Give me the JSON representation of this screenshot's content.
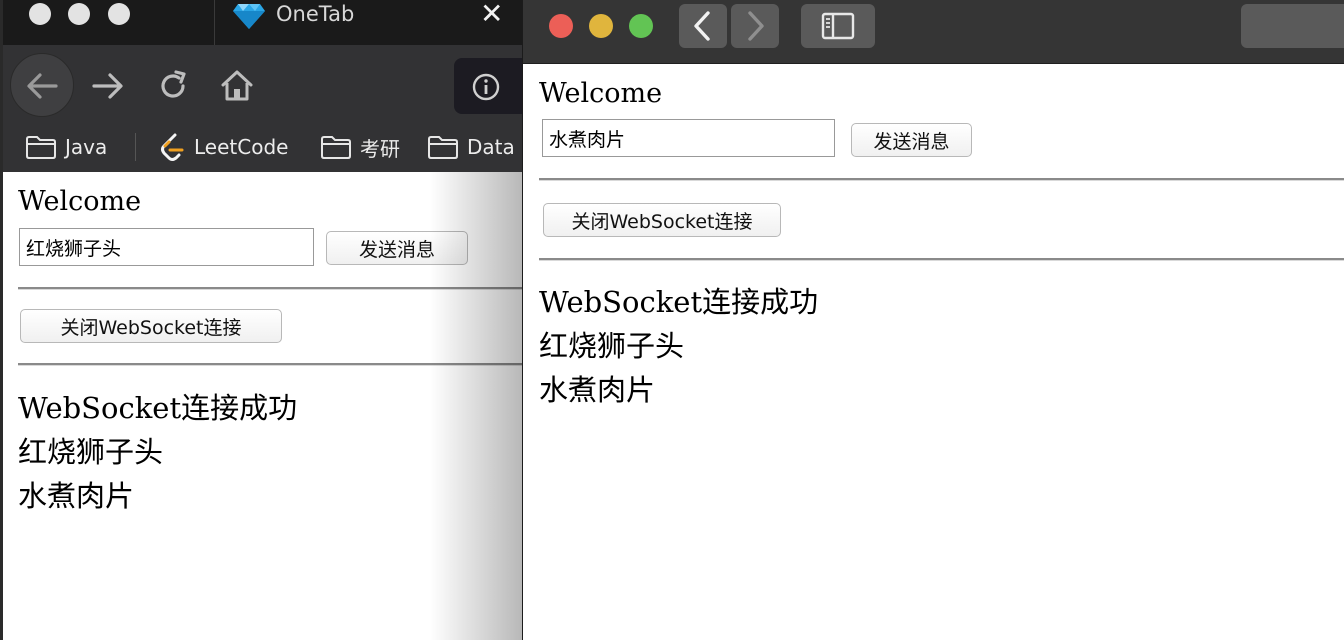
{
  "left_window": {
    "tab": {
      "title": "OneTab",
      "close_glyph": "✕",
      "icon": "onetab-diamond-icon"
    },
    "toolbar": {
      "back_icon": "back-arrow-icon",
      "forward_icon": "forward-arrow-icon",
      "reload_icon": "reload-icon",
      "home_icon": "home-icon",
      "info_icon": "info-icon"
    },
    "bookmarks": [
      {
        "label": "Java",
        "icon": "folder-icon"
      },
      {
        "label": "LeetCode",
        "icon": "leetcode-icon"
      },
      {
        "label": "考研",
        "icon": "folder-icon"
      },
      {
        "label": "Data",
        "icon": "folder-icon"
      }
    ],
    "page": {
      "title": "Welcome",
      "input_value": "红烧狮子头",
      "send_button": "发送消息",
      "close_button": "关闭WebSocket连接",
      "messages": [
        "WebSocket连接成功",
        "红烧狮子头",
        "水煮肉片"
      ]
    }
  },
  "right_window": {
    "traffic_lights": {
      "close": "#ec5f57",
      "minimize": "#e0b53d",
      "zoom": "#62c454"
    },
    "toolbar": {
      "back_icon": "chevron-left-icon",
      "forward_icon": "chevron-right-icon",
      "sidebar_icon": "sidebar-icon"
    },
    "page": {
      "title": "Welcome",
      "input_value": "水煮肉片",
      "send_button": "发送消息",
      "close_button": "关闭WebSocket连接",
      "messages": [
        "WebSocket连接成功",
        "红烧狮子头",
        "水煮肉片"
      ]
    }
  }
}
